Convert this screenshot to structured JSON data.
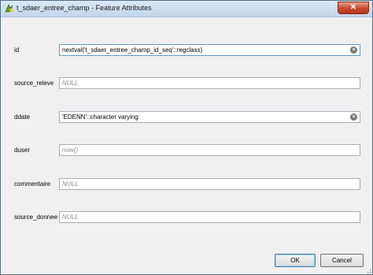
{
  "window": {
    "title": "t_sdaer_entree_champ - Feature Attributes",
    "close_symbol": "✕"
  },
  "fields": [
    {
      "label": "id",
      "value": "nextval('t_sdaer_entree_champ_id_seq'::regclass)",
      "placeholder": ""
    },
    {
      "label": "source_releve",
      "value": "",
      "placeholder": "NULL"
    },
    {
      "label": "ddate",
      "value": "'EDENN'::character varying",
      "placeholder": ""
    },
    {
      "label": "duser",
      "value": "",
      "placeholder": "now()"
    },
    {
      "label": "commentaire",
      "value": "",
      "placeholder": "NULL"
    },
    {
      "label": "source_donnee",
      "value": "",
      "placeholder": "NULL"
    }
  ],
  "buttons": {
    "ok": "OK",
    "cancel": "Cancel"
  },
  "icons": {
    "app": "qgis-icon",
    "clear": "clear-icon",
    "close": "close-icon"
  },
  "colors": {
    "desktop": "#6e8fb2",
    "titlebar": "#c3d6ec",
    "close_button": "#c8482e",
    "dialog_bg": "#f0f0f0"
  }
}
